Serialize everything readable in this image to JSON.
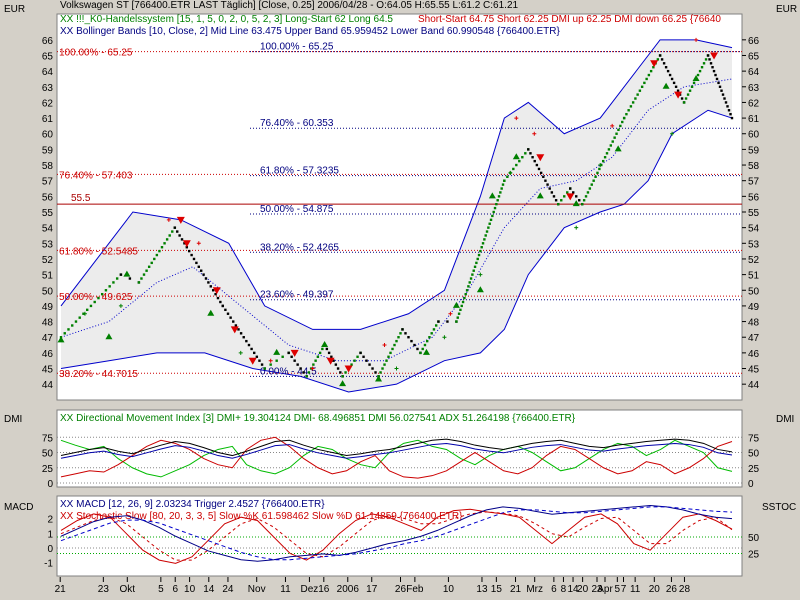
{
  "chart_data": [
    {
      "type": "line",
      "panel": "price",
      "unit_label": "EUR",
      "header": [
        {
          "text": "Volkswagen ST [766400.ETR LAST Täglich] [Close, 0.25] 2006/04/28 - O:64.05 H:65.55 L:61.2 C:61.21",
          "color": "#000000"
        },
        {
          "text": "XX !!!_K0-Handelssystem [15, 1, 5, 0, 2, 0, 5, 2, 3] Long-Start 62 Long 64.5",
          "color": "#008000"
        },
        {
          "text": "Short-Start 64.75 Short 62.25 DMI up 62.25 DMI down 66.25 {76640",
          "color": "#cc0000"
        },
        {
          "text": "XX Bollinger Bands [10, Close, 2] Mid Line 63.475 Upper Band 65.959452 Lower Band 60.990548 {766400.ETR}",
          "color": "#000080"
        }
      ],
      "ylim": [
        43.5,
        66.5
      ],
      "yticks": [
        44,
        45,
        46,
        47,
        48,
        49,
        50,
        51,
        52,
        53,
        54,
        55,
        56,
        57,
        58,
        59,
        60,
        61,
        62,
        63,
        64,
        65,
        66
      ],
      "price_path": [
        {
          "x": 0,
          "y": 47
        },
        {
          "x": 10,
          "y": 51
        },
        {
          "x": 13,
          "y": 50.5
        },
        {
          "x": 19,
          "y": 54
        },
        {
          "x": 27,
          "y": 49
        },
        {
          "x": 34,
          "y": 45
        },
        {
          "x": 38,
          "y": 46
        },
        {
          "x": 41,
          "y": 44.5
        },
        {
          "x": 44,
          "y": 46.5
        },
        {
          "x": 47,
          "y": 44.5
        },
        {
          "x": 50,
          "y": 46
        },
        {
          "x": 53,
          "y": 44.5
        },
        {
          "x": 57,
          "y": 47.5
        },
        {
          "x": 60,
          "y": 46
        },
        {
          "x": 63,
          "y": 48
        },
        {
          "x": 66,
          "y": 48
        },
        {
          "x": 74,
          "y": 57
        },
        {
          "x": 78,
          "y": 59
        },
        {
          "x": 83,
          "y": 55.5
        },
        {
          "x": 85,
          "y": 56.5
        },
        {
          "x": 87,
          "y": 55.5
        },
        {
          "x": 94,
          "y": 61
        },
        {
          "x": 100,
          "y": 65
        },
        {
          "x": 104,
          "y": 62
        },
        {
          "x": 108,
          "y": 65
        },
        {
          "x": 112,
          "y": 61
        }
      ],
      "bollinger_upper": [
        {
          "x": 0,
          "y": 49
        },
        {
          "x": 6,
          "y": 52
        },
        {
          "x": 12,
          "y": 55
        },
        {
          "x": 20,
          "y": 54.5
        },
        {
          "x": 28,
          "y": 53
        },
        {
          "x": 34,
          "y": 49
        },
        {
          "x": 42,
          "y": 47.5
        },
        {
          "x": 50,
          "y": 47.5
        },
        {
          "x": 58,
          "y": 48.5
        },
        {
          "x": 64,
          "y": 50
        },
        {
          "x": 70,
          "y": 56
        },
        {
          "x": 74,
          "y": 61
        },
        {
          "x": 78,
          "y": 62
        },
        {
          "x": 84,
          "y": 60
        },
        {
          "x": 90,
          "y": 61
        },
        {
          "x": 96,
          "y": 64
        },
        {
          "x": 100,
          "y": 66
        },
        {
          "x": 106,
          "y": 66
        },
        {
          "x": 112,
          "y": 65.5
        }
      ],
      "bollinger_mid": [
        {
          "x": 0,
          "y": 47
        },
        {
          "x": 8,
          "y": 48
        },
        {
          "x": 16,
          "y": 50.5
        },
        {
          "x": 22,
          "y": 51.5
        },
        {
          "x": 30,
          "y": 49
        },
        {
          "x": 38,
          "y": 46.5
        },
        {
          "x": 46,
          "y": 45.5
        },
        {
          "x": 54,
          "y": 45.5
        },
        {
          "x": 62,
          "y": 47
        },
        {
          "x": 68,
          "y": 50
        },
        {
          "x": 74,
          "y": 54
        },
        {
          "x": 80,
          "y": 56.5
        },
        {
          "x": 86,
          "y": 57
        },
        {
          "x": 92,
          "y": 58.5
        },
        {
          "x": 98,
          "y": 61.5
        },
        {
          "x": 104,
          "y": 63
        },
        {
          "x": 112,
          "y": 63.5
        }
      ],
      "bollinger_lower": [
        {
          "x": 0,
          "y": 45
        },
        {
          "x": 8,
          "y": 45.5
        },
        {
          "x": 16,
          "y": 46
        },
        {
          "x": 24,
          "y": 46
        },
        {
          "x": 32,
          "y": 45
        },
        {
          "x": 40,
          "y": 44.5
        },
        {
          "x": 48,
          "y": 43.5
        },
        {
          "x": 56,
          "y": 44
        },
        {
          "x": 64,
          "y": 45.5
        },
        {
          "x": 70,
          "y": 46
        },
        {
          "x": 74,
          "y": 47.5
        },
        {
          "x": 78,
          "y": 51
        },
        {
          "x": 84,
          "y": 54
        },
        {
          "x": 90,
          "y": 55
        },
        {
          "x": 94,
          "y": 55.5
        },
        {
          "x": 98,
          "y": 57
        },
        {
          "x": 102,
          "y": 60
        },
        {
          "x": 108,
          "y": 61.5
        },
        {
          "x": 112,
          "y": 61
        }
      ],
      "fib_left": [
        {
          "label": "100.00% - 65.25",
          "y": 65.25
        },
        {
          "label": "76.40% - 57.403",
          "y": 57.403
        },
        {
          "label": "61.80% - 52.5485",
          "y": 52.5485
        },
        {
          "label": "50.00% - 49.625",
          "y": 49.625
        },
        {
          "label": "38.20% - 44.7015",
          "y": 44.7015
        }
      ],
      "fib_mid": [
        {
          "label": "100.00% - 65.25",
          "y": 65.25
        },
        {
          "label": "76.40% - 60.353",
          "y": 60.353
        },
        {
          "label": "61.80% - 57.3235",
          "y": 57.3235
        },
        {
          "label": "50.00% - 54.875",
          "y": 54.875
        },
        {
          "label": "38.20% - 52.4265",
          "y": 52.4265
        },
        {
          "label": "23.60% - 49.397",
          "y": 49.397
        },
        {
          "label": "0.00% - 44.5",
          "y": 44.5
        }
      ],
      "support_line": {
        "label": "55.5",
        "y": 55.5
      },
      "markers": {
        "green_up": [
          [
            0,
            46.8
          ],
          [
            8,
            47
          ],
          [
            11,
            51
          ],
          [
            25,
            48.5
          ],
          [
            36,
            46
          ],
          [
            44,
            46.5
          ],
          [
            47,
            44
          ],
          [
            53,
            44.3
          ],
          [
            61,
            46
          ],
          [
            66,
            49
          ],
          [
            70,
            50
          ],
          [
            72,
            56
          ],
          [
            76,
            58.5
          ],
          [
            80,
            56
          ],
          [
            86,
            55.5
          ],
          [
            93,
            59
          ],
          [
            101,
            63
          ],
          [
            106,
            63.5
          ]
        ],
        "red_down": [
          [
            20,
            54.5
          ],
          [
            21,
            53
          ],
          [
            26,
            50
          ],
          [
            29,
            47.5
          ],
          [
            32,
            45.5
          ],
          [
            39,
            46
          ],
          [
            45,
            45.5
          ],
          [
            48,
            45
          ],
          [
            80,
            58.5
          ],
          [
            85,
            56
          ],
          [
            99,
            64.5
          ],
          [
            103,
            62.5
          ],
          [
            109,
            65
          ]
        ],
        "green_plus": [
          [
            4,
            48.5
          ],
          [
            10,
            49
          ],
          [
            30,
            46
          ],
          [
            56,
            45
          ],
          [
            64,
            47
          ],
          [
            70,
            51
          ],
          [
            75,
            57.5
          ],
          [
            86,
            54
          ],
          [
            90,
            58
          ],
          [
            102,
            60
          ]
        ],
        "red_plus": [
          [
            18,
            54.5
          ],
          [
            23,
            53
          ],
          [
            35,
            45.5
          ],
          [
            42,
            45
          ],
          [
            54,
            46.5
          ],
          [
            65,
            48.5
          ],
          [
            76,
            61
          ],
          [
            79,
            60
          ],
          [
            92,
            60.5
          ],
          [
            106,
            66
          ]
        ]
      }
    },
    {
      "type": "line",
      "panel": "dmi",
      "left_label": "DMI",
      "right_label": "DMI",
      "legend": "XX Directional Movement Index [3] DMI+ 19.304124 DMI- 68.496851 DMI 56.027541 ADX 51.264198 {766400.ETR}",
      "ylim": [
        0,
        100
      ],
      "yticks": [
        0,
        25,
        50,
        75
      ],
      "dmi_plus": [
        70,
        62,
        55,
        60,
        40,
        25,
        15,
        10,
        20,
        30,
        45,
        55,
        60,
        30,
        20,
        15,
        25,
        45,
        60,
        55,
        40,
        30,
        25,
        50,
        65,
        70,
        60,
        55,
        40,
        30,
        45,
        55,
        60,
        50,
        35,
        20,
        25,
        40,
        55,
        65,
        60,
        45,
        55,
        70,
        60,
        50,
        25,
        19
      ],
      "dmi_minus": [
        10,
        15,
        20,
        18,
        30,
        45,
        60,
        70,
        65,
        55,
        40,
        30,
        25,
        55,
        70,
        75,
        60,
        40,
        25,
        15,
        20,
        35,
        45,
        20,
        10,
        8,
        12,
        20,
        35,
        50,
        35,
        20,
        15,
        25,
        45,
        60,
        55,
        40,
        25,
        15,
        20,
        35,
        30,
        15,
        25,
        40,
        60,
        68
      ],
      "adx": [
        45,
        50,
        55,
        58,
        52,
        48,
        55,
        62,
        68,
        65,
        58,
        50,
        45,
        52,
        60,
        68,
        70,
        62,
        55,
        50,
        45,
        48,
        52,
        55,
        60,
        65,
        70,
        72,
        68,
        62,
        58,
        55,
        60,
        65,
        68,
        70,
        65,
        60,
        58,
        62,
        65,
        68,
        70,
        72,
        70,
        65,
        55,
        51
      ]
    },
    {
      "type": "line",
      "panel": "macd",
      "left_label": "MACD",
      "right_label": "SSTOC",
      "legend_macd": "XX MACD [12, 26, 9] 2.03234 Trigger 2.4527 {766400.ETR}",
      "legend_stoch": "XX Stochastic Slow [80, 20, 3, 3, 5] Slow %K 61.598462 Slow %D 61.14859 {766400.ETR}",
      "ylim_left": [
        -1.5,
        3
      ],
      "yticks_left": [
        -1,
        0,
        1,
        2
      ],
      "yticks_right": [
        25,
        50
      ],
      "macd": [
        0.8,
        1.3,
        1.8,
        2.1,
        2.2,
        1.9,
        1.4,
        0.8,
        0.3,
        -0.2,
        -0.5,
        -0.8,
        -0.9,
        -0.8,
        -0.6,
        -0.5,
        -0.4,
        -0.5,
        -0.3,
        0.0,
        0.3,
        0.5,
        0.8,
        1.2,
        1.7,
        2.2,
        2.6,
        2.8,
        2.7,
        2.5,
        2.3,
        2.4,
        2.5,
        2.6,
        2.7,
        2.8,
        2.9,
        2.8,
        2.6,
        2.3,
        2.1,
        2.0
      ],
      "trigger": [
        0.5,
        0.9,
        1.3,
        1.7,
        1.9,
        1.9,
        1.7,
        1.3,
        0.9,
        0.5,
        0.1,
        -0.3,
        -0.6,
        -0.8,
        -0.8,
        -0.7,
        -0.6,
        -0.5,
        -0.4,
        -0.2,
        0.0,
        0.3,
        0.5,
        0.8,
        1.2,
        1.6,
        2.0,
        2.4,
        2.6,
        2.6,
        2.5,
        2.4,
        2.4,
        2.5,
        2.6,
        2.7,
        2.8,
        2.8,
        2.7,
        2.6,
        2.5,
        2.45
      ],
      "stoch_k": [
        60,
        75,
        85,
        80,
        55,
        30,
        15,
        10,
        20,
        45,
        70,
        80,
        75,
        50,
        25,
        15,
        30,
        55,
        75,
        85,
        80,
        70,
        60,
        80,
        90,
        92,
        88,
        85,
        80,
        60,
        40,
        60,
        80,
        85,
        70,
        40,
        30,
        55,
        80,
        85,
        75,
        62
      ],
      "stoch_d": [
        55,
        65,
        75,
        80,
        70,
        50,
        30,
        15,
        15,
        30,
        50,
        70,
        78,
        65,
        45,
        25,
        20,
        35,
        55,
        75,
        82,
        78,
        70,
        70,
        78,
        85,
        88,
        86,
        82,
        70,
        55,
        50,
        65,
        78,
        80,
        60,
        40,
        40,
        60,
        75,
        80,
        61
      ]
    }
  ],
  "x_axis": {
    "span": [
      0,
      112
    ],
    "ticks": [
      {
        "label": "21",
        "x": 0
      },
      {
        "label": "23",
        "x": 9
      },
      {
        "label": "Okt",
        "x": 14
      },
      {
        "label": "5",
        "x": 21
      },
      {
        "label": "6",
        "x": 24
      },
      {
        "label": "10",
        "x": 27
      },
      {
        "label": "14",
        "x": 31
      },
      {
        "label": "24",
        "x": 35
      },
      {
        "label": "Nov",
        "x": 41
      },
      {
        "label": "11",
        "x": 47
      },
      {
        "label": "Dez",
        "x": 52
      },
      {
        "label": "16",
        "x": 55
      },
      {
        "label": "2006",
        "x": 60
      },
      {
        "label": "17",
        "x": 65
      },
      {
        "label": "26",
        "x": 71
      },
      {
        "label": "Feb",
        "x": 74
      },
      {
        "label": "10",
        "x": 81
      },
      {
        "label": "13",
        "x": 88
      },
      {
        "label": "15",
        "x": 91
      },
      {
        "label": "21",
        "x": 95
      },
      {
        "label": "Mrz",
        "x": 99
      },
      {
        "label": "6",
        "x": 103
      },
      {
        "label": "8",
        "x": 105
      },
      {
        "label": "14",
        "x": 107
      },
      {
        "label": "20",
        "x": 109
      },
      {
        "label": "23",
        "x": 112
      }
    ]
  },
  "x_axis_extra_ticks": [
    {
      "label": "Apr",
      "pos": 0.8
    },
    {
      "label": "5",
      "pos": 0.818
    },
    {
      "label": "7",
      "pos": 0.827
    },
    {
      "label": "11",
      "pos": 0.844
    },
    {
      "label": "20",
      "pos": 0.872
    },
    {
      "label": "26",
      "pos": 0.897
    },
    {
      "label": "28",
      "pos": 0.916
    }
  ],
  "colors": {
    "background": "#d4d0c8",
    "panel": "#ffffff",
    "band_fill": "#ececec",
    "band_line": "#0000cc",
    "mid_line": "#0000cc",
    "price_up": "#008000",
    "price_down": "#000000",
    "fib_line": "#cc0000",
    "support": "#aa0000",
    "dmi_plus": "#00bb00",
    "dmi_minus": "#cc0000",
    "adx": "#000000",
    "macd": "#000088",
    "trigger": "#0000cc",
    "stoch": "#cc0000"
  }
}
